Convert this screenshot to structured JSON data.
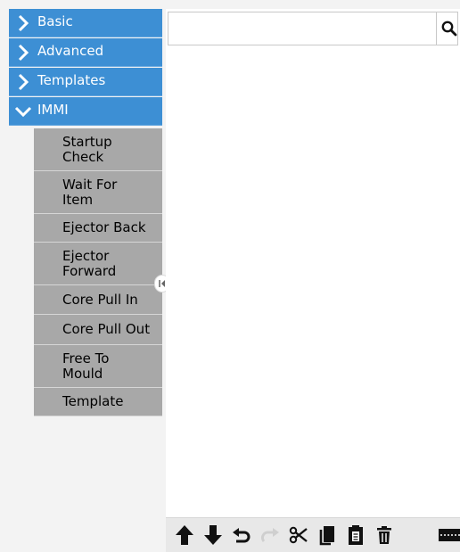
{
  "categories": [
    {
      "label": "Basic",
      "icon": "chevron-right-icon",
      "expanded": false
    },
    {
      "label": "Advanced",
      "icon": "chevron-right-icon",
      "expanded": false
    },
    {
      "label": "Templates",
      "icon": "chevron-right-icon",
      "expanded": false
    },
    {
      "label": "IMMI",
      "icon": "chevron-down-icon",
      "expanded": true
    }
  ],
  "immi_items": [
    "Startup\nCheck",
    "Wait For\nItem",
    "Ejector Back",
    "Ejector\nForward",
    "Core Pull In",
    "Core Pull Out",
    "Free To\nMould",
    "Template"
  ],
  "search": {
    "value": "",
    "icon": "search-icon"
  },
  "toolbar": {
    "icons": [
      "move-up-icon",
      "move-down-icon",
      "undo-icon",
      "redo-icon",
      "cut-icon",
      "copy-icon",
      "paste-icon",
      "delete-icon",
      "suppress-icon"
    ]
  },
  "colors": {
    "category_bg": "#3d8fd4",
    "item_bg": "#a8a8a8",
    "panel_bg": "#f3f3f3"
  }
}
